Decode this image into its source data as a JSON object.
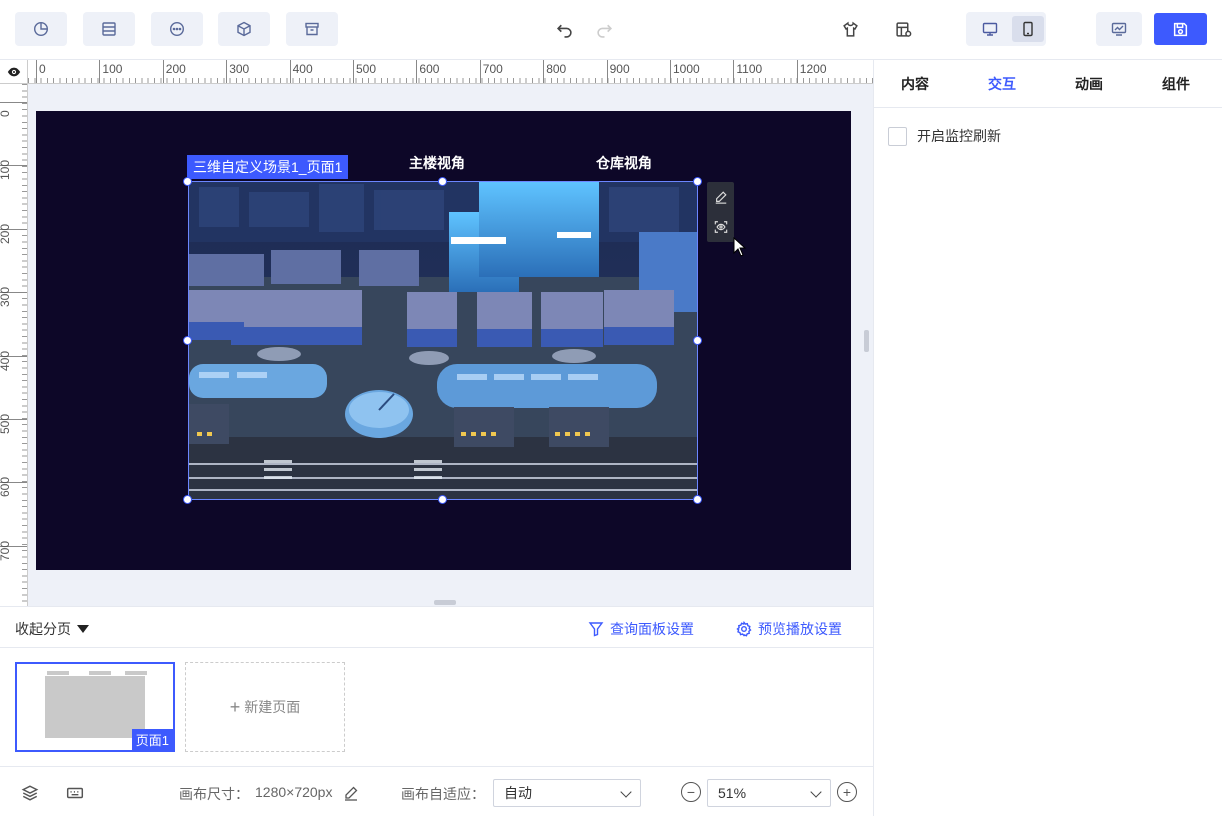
{
  "toolbar": {
    "left_icons": [
      "chart-icon",
      "table-icon",
      "more-icon",
      "cube-icon",
      "archive-icon"
    ],
    "undo_icon": "undo-icon",
    "redo_icon": "redo-icon",
    "theme_icon": "shirt-icon",
    "template_icon": "template-icon",
    "device_pc_icon": "monitor-icon",
    "device_mobile_icon": "mobile-icon",
    "preview_icon": "preview-icon",
    "save_icon": "save-icon"
  },
  "ruler": {
    "h_ticks": [
      "0",
      "100",
      "200",
      "300",
      "400",
      "500",
      "600",
      "700",
      "800",
      "900",
      "1000",
      "1100",
      "1200"
    ],
    "v_ticks": [
      "0",
      "100",
      "200",
      "300",
      "400",
      "500",
      "600",
      "700"
    ]
  },
  "canvas": {
    "titles": [
      "主楼视角",
      "仓库视角"
    ],
    "selected_label": "三维自定义场景1_页面1",
    "background_color": "#0d0728"
  },
  "right_panel": {
    "tabs": [
      "内容",
      "交互",
      "动画",
      "组件"
    ],
    "active_tab": "交互",
    "checkbox_label": "开启监控刷新",
    "checkbox_checked": false
  },
  "page_bar": {
    "collapse_label": "收起分页",
    "query_panel_label": "查询面板设置",
    "preview_play_label": "预览播放设置"
  },
  "pages": {
    "thumb_label": "页面1",
    "new_page_label": "新建页面"
  },
  "status_bar": {
    "canvas_size_label": "画布尺寸：",
    "canvas_size_value": "1280×720px",
    "adapt_label": "画布自适应：",
    "adapt_value": "自动",
    "zoom_value": "51%"
  },
  "colors": {
    "accent": "#3d5afe"
  }
}
